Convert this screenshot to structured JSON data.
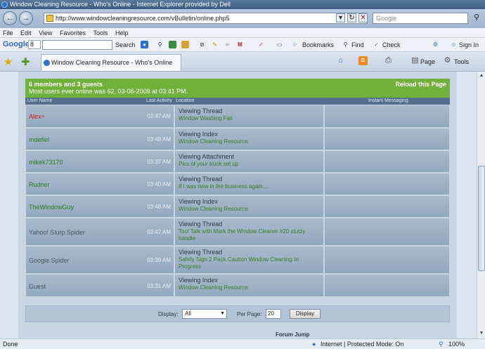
{
  "window": {
    "title": "Window Cleaning Resource - Who's Online - Internet Explorer provided by Dell"
  },
  "address": {
    "url": "http://www.windowcleaningresource.com/vBulletin/online.php5",
    "search_placeholder": "Google"
  },
  "menu": [
    "File",
    "Edit",
    "View",
    "Favorites",
    "Tools",
    "Help"
  ],
  "googlebar": {
    "logo": "Google",
    "selector": "8",
    "search_label": "Search",
    "bookmarks_label": "Bookmarks",
    "find_label": "Find",
    "check_label": "Check",
    "signin_label": "Sign In"
  },
  "tabbar": {
    "tab_title": "Window Cleaning Resource - Who's Online",
    "page_label": "Page",
    "tools_label": "Tools"
  },
  "whos_online": {
    "headline": "6 members and 3 guests",
    "subline": "Most users ever online was 62, 03-06-2009 at 03:41 PM.",
    "reload": "Reload this Page",
    "columns": {
      "user": "User Name",
      "activity": "Last Activity",
      "location": "Location",
      "im": "Instant Messaging"
    },
    "rows": [
      {
        "user": "Alex+",
        "type": "admin",
        "time": "03:47 AM",
        "action": "Viewing Thread",
        "detail": "Window Washing Fail"
      },
      {
        "user": "mdefiel",
        "type": "member",
        "time": "03:48 AM",
        "action": "Viewing Index",
        "detail": "Window Cleaning Resource"
      },
      {
        "user": "mikek73170",
        "type": "member",
        "time": "03:37 AM",
        "action": "Viewing Attachment",
        "detail": "Pics of your truck set up"
      },
      {
        "user": "Rudner",
        "type": "member",
        "time": "03:40 AM",
        "action": "Viewing Thread",
        "detail": "If I was new in the business again...."
      },
      {
        "user": "TheWindowGuy",
        "type": "member",
        "time": "03:48 AM",
        "action": "Viewing Index",
        "detail": "Window Cleaning Resource"
      },
      {
        "user": "Yahoo! Slurp Spider",
        "type": "guest",
        "time": "03:47 AM",
        "action": "Viewing Thread",
        "detail": "Tool Talk with Mark the Window Cleaner #20 stutzy handle"
      },
      {
        "user": "Google Spider",
        "type": "guest",
        "time": "03:39 AM",
        "action": "Viewing Thread",
        "detail": "Safety Sign 2 Pack Caution Window Cleaning In Progress"
      },
      {
        "user": "Guest",
        "type": "guest",
        "time": "03:31 AM",
        "action": "Viewing Index",
        "detail": "Window Cleaning Resource"
      }
    ]
  },
  "footer": {
    "display_label": "Display:",
    "display_value": "All",
    "perpage_label": "Per Page:",
    "perpage_value": "20",
    "button": "Display",
    "forum_jump": "Forum Jump"
  },
  "status": {
    "left": "Done",
    "zone": "Internet | Protected Mode: On",
    "zoom": "100%"
  }
}
